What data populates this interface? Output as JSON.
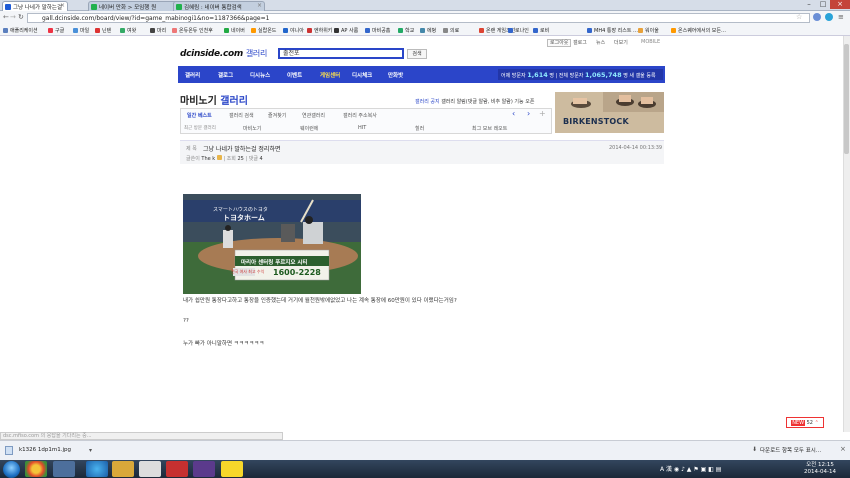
{
  "browser": {
    "tabs": [
      {
        "title": "그냥 나네가 말하는걸",
        "active": true,
        "fav": "#1e5bd6"
      },
      {
        "title": "네이버 만화 > 모임행 원",
        "active": false,
        "fav": "#21b14d"
      },
      {
        "title": "김혜림 : 네이버 통합검색",
        "active": false,
        "fav": "#21b14d"
      }
    ],
    "url": "gall.dcinside.com/board/view/?id=game_mabinogi1&no=1187366&page=1",
    "bookmarks": [
      "애플리케이션",
      "구글",
      "마일",
      "닌텐",
      "여왓",
      "마리",
      "온듀온듀 인천후",
      "네이버",
      "실랍온드",
      "야니아",
      "엔하위키",
      "AP 사룸",
      "마비공홈",
      "학교",
      "에벙",
      "의료",
      "온랜 게임조선",
      "로나인",
      "로비",
      "MH4 통장 리스트 …",
      "워이울",
      "온스퀘어에서의 모든…"
    ]
  },
  "site": {
    "util": [
      "로그아웃",
      "갤로그",
      "뉴스",
      "더보기",
      "MOBILE"
    ],
    "logo": "dcinside.com",
    "logo_sub": "갤러리",
    "search_value": "출전포",
    "search_btn": "검색",
    "gnb": [
      "갤러리",
      "갤로그",
      "디시뉴스",
      "이벤트",
      "게임센터",
      "디시체크",
      "만화밧"
    ],
    "visitors": {
      "label1": "어제 방문자",
      "v1": "1,614",
      "label2": "명 | 전체 방문자",
      "v2": "1,065,748",
      "label3": "명 새 갤울 등록"
    },
    "gallery_title": "마비노기",
    "gallery_title_sub": "갤러리",
    "notice_label": "갤러리 공지",
    "notice_text": "갤러리 알림(댓글 알람, 비추 알람) 기능 오픈",
    "tabs_row1": [
      "일간 베스트",
      "갤러리 검색",
      "즐겨찾기",
      "연관갤러리",
      "갤러리 주소복사"
    ],
    "tabs_row2": [
      "최근 방문 갤러리",
      "마비노기",
      "웨이런에",
      "HIT",
      "힐러",
      "최그 모브 레오트"
    ],
    "ad_text": "BIRKENSTOCK"
  },
  "post": {
    "label": "제 목",
    "title": "그냥 나네가 말하는걸 정리하면",
    "date": "2014-04-14 00:13:39",
    "author_label": "글쓴이",
    "author": "The k",
    "views_label": "조회",
    "views": "25",
    "comments_label": "댓글",
    "comments": "4",
    "photo_banner_title": "마리아 센터링 푸르지오 시티",
    "photo_phone": "1600-2228",
    "photo_sub": "전국 여사 최고 수익",
    "photo_dome": "トヨタホーム",
    "photo_top": "スマートハウスのトヨタ",
    "body": [
      "내가 쉽만원 통장다고하고 통장을 인증했는데 거기에 월천원밖에없었고 나는 계속 통장에 60만원이 있다 이랬다는거임?",
      "??",
      "누가 빠가 아니말하면 ㅋㅋㅋㅋㅋㅋ"
    ]
  },
  "top_button": {
    "new": "NEW",
    "count": "52"
  },
  "status_text": "dsc.mfiso.com 의 응답을 기다리는 중...",
  "download": {
    "file": "k1326 1dp1m1.jpg",
    "all": "다운로드 항목 모두 표시..."
  },
  "taskbar": {
    "time": "오전 12:15",
    "date": "2014-04-14",
    "lang": "A 漢"
  }
}
